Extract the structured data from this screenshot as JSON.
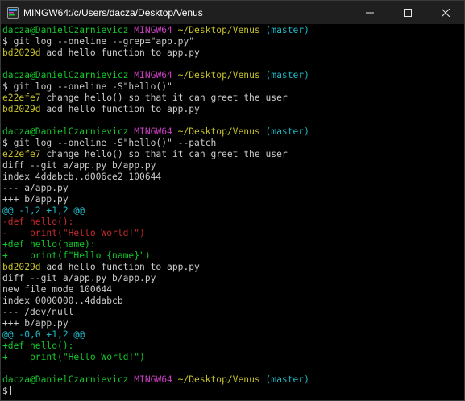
{
  "window": {
    "title": "MINGW64:/c/Users/dacza/Desktop/Venus",
    "minimize_icon": "minimize-icon",
    "maximize_icon": "maximize-icon",
    "close_icon": "close-icon"
  },
  "colors": {
    "background": "#000000",
    "green": "#13c729",
    "magenta": "#c83fbe",
    "yellow": "#c6c127",
    "cyan": "#1fb9c7",
    "white": "#cccccc",
    "red": "#c42a2a"
  },
  "terminal": {
    "lines": [
      [
        {
          "t": "dacza@DanielCzarnievicz ",
          "c": "green"
        },
        {
          "t": "MINGW64 ",
          "c": "magenta"
        },
        {
          "t": "~/Desktop/Venus ",
          "c": "yellow"
        },
        {
          "t": "(master)",
          "c": "cyan"
        }
      ],
      [
        {
          "t": "$ git log --oneline --grep=\"app.py\"",
          "c": "white"
        }
      ],
      [
        {
          "t": "bd2029d",
          "c": "yellow"
        },
        {
          "t": " add hello function to app.py",
          "c": "white"
        }
      ],
      [],
      [
        {
          "t": "dacza@DanielCzarnievicz ",
          "c": "green"
        },
        {
          "t": "MINGW64 ",
          "c": "magenta"
        },
        {
          "t": "~/Desktop/Venus ",
          "c": "yellow"
        },
        {
          "t": "(master)",
          "c": "cyan"
        }
      ],
      [
        {
          "t": "$ git log --oneline -S\"hello()\"",
          "c": "white"
        }
      ],
      [
        {
          "t": "e22efe7",
          "c": "yellow"
        },
        {
          "t": " change hello() so that it can greet the user",
          "c": "white"
        }
      ],
      [
        {
          "t": "bd2029d",
          "c": "yellow"
        },
        {
          "t": " add hello function to app.py",
          "c": "white"
        }
      ],
      [],
      [
        {
          "t": "dacza@DanielCzarnievicz ",
          "c": "green"
        },
        {
          "t": "MINGW64 ",
          "c": "magenta"
        },
        {
          "t": "~/Desktop/Venus ",
          "c": "yellow"
        },
        {
          "t": "(master)",
          "c": "cyan"
        }
      ],
      [
        {
          "t": "$ git log --oneline -S\"hello()\" --patch",
          "c": "white"
        }
      ],
      [
        {
          "t": "e22efe7",
          "c": "yellow"
        },
        {
          "t": " change hello() so that it can greet the user",
          "c": "white"
        }
      ],
      [
        {
          "t": "diff --git a/app.py b/app.py",
          "c": "white"
        }
      ],
      [
        {
          "t": "index 4ddabcb..d006ce2 100644",
          "c": "white"
        }
      ],
      [
        {
          "t": "--- a/app.py",
          "c": "white"
        }
      ],
      [
        {
          "t": "+++ b/app.py",
          "c": "white"
        }
      ],
      [
        {
          "t": "@@ -1,2 +1,2 @@",
          "c": "cyan"
        }
      ],
      [
        {
          "t": "-def hello():",
          "c": "red"
        }
      ],
      [
        {
          "t": "-    print(\"Hello World!\")",
          "c": "red"
        }
      ],
      [
        {
          "t": "+def hello(name):",
          "c": "green"
        }
      ],
      [
        {
          "t": "+    print(f\"Hello {name}\")",
          "c": "green"
        }
      ],
      [
        {
          "t": "bd2029d",
          "c": "yellow"
        },
        {
          "t": " add hello function to app.py",
          "c": "white"
        }
      ],
      [
        {
          "t": "diff --git a/app.py b/app.py",
          "c": "white"
        }
      ],
      [
        {
          "t": "new file mode 100644",
          "c": "white"
        }
      ],
      [
        {
          "t": "index 0000000..4ddabcb",
          "c": "white"
        }
      ],
      [
        {
          "t": "--- /dev/null",
          "c": "white"
        }
      ],
      [
        {
          "t": "+++ b/app.py",
          "c": "white"
        }
      ],
      [
        {
          "t": "@@ -0,0 +1,2 @@",
          "c": "cyan"
        }
      ],
      [
        {
          "t": "+def hello():",
          "c": "green"
        }
      ],
      [
        {
          "t": "+    print(\"Hello World!\")",
          "c": "green"
        }
      ],
      [],
      [
        {
          "t": "dacza@DanielCzarnievicz ",
          "c": "green"
        },
        {
          "t": "MINGW64 ",
          "c": "magenta"
        },
        {
          "t": "~/Desktop/Venus ",
          "c": "yellow"
        },
        {
          "t": "(master)",
          "c": "cyan"
        }
      ],
      [
        {
          "t": "$",
          "c": "white",
          "cursor": true
        }
      ]
    ]
  }
}
